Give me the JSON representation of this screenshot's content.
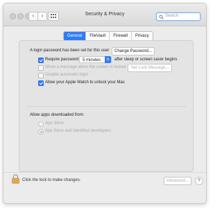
{
  "window": {
    "title": "Security & Privacy",
    "search_placeholder": "Search"
  },
  "nav": {
    "back": "‹",
    "forward": "›"
  },
  "tabs": [
    "General",
    "FileVault",
    "Firewall",
    "Privacy"
  ],
  "general": {
    "login_text": "A login password has been set for this user",
    "change_password_label": "Change Password...",
    "require_password_label": "Require password",
    "require_password_value": "5 minutes",
    "require_password_suffix": "after sleep or screen saver begins",
    "show_message_label": "Show a message when the screen is locked",
    "set_lock_message_label": "Set Lock Message...",
    "disable_auto_login_label": "Disable automatic login",
    "apple_watch_label": "Allow your Apple Watch to unlock your Mac"
  },
  "downloads": {
    "heading": "Allow apps downloaded from:",
    "options": [
      "App Store",
      "App Store and identified developers"
    ]
  },
  "footer": {
    "lock_text": "Click the lock to make changes.",
    "advanced_label": "Advanced...",
    "help_label": "?"
  }
}
